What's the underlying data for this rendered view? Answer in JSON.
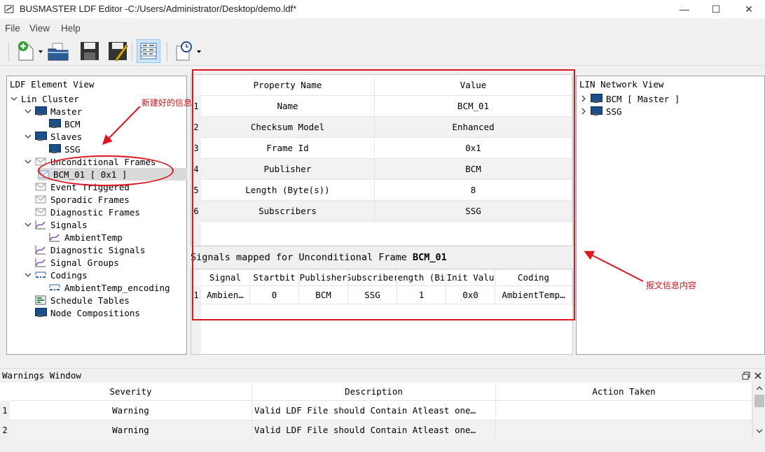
{
  "window": {
    "title": "BUSMASTER LDF Editor -C:/Users/Administrator/Desktop/demo.ldf*",
    "minimize_glyph": "—",
    "maximize_glyph": "☐",
    "close_glyph": "✕"
  },
  "menu": {
    "file": "File",
    "view": "View",
    "help": "Help"
  },
  "toolbar": {
    "icons": [
      "new-icon",
      "open-icon",
      "save-icon",
      "save-as-icon",
      "table-icon",
      "schedule-icon"
    ]
  },
  "left_panel": {
    "title": "LDF Element View",
    "tree": {
      "root": "Lin Cluster",
      "master": "Master",
      "master_bcm": "BCM",
      "slaves": "Slaves",
      "slaves_ssg": "SSG",
      "unconditional_frames": "Unconditional Frames",
      "frame_bcm01": "BCM_01 [ 0x1 ]",
      "event_triggered": "Event Triggered",
      "sporadic_frames": "Sporadic Frames",
      "diagnostic_frames": "Diagnostic Frames",
      "signals": "Signals",
      "signal_ambient": "AmbientTemp",
      "diagnostic_signals": "Diagnostic Signals",
      "signal_groups": "Signal Groups",
      "codings": "Codings",
      "coding_ambient": "AmbientTemp_encoding",
      "schedule_tables": "Schedule Tables",
      "node_compositions": "Node Compositions"
    }
  },
  "property_grid": {
    "headers": [
      "Property Name",
      "Value"
    ],
    "rows": [
      {
        "num": "1",
        "name": "Name",
        "value": "BCM_01"
      },
      {
        "num": "2",
        "name": "Checksum Model",
        "value": "Enhanced"
      },
      {
        "num": "3",
        "name": "Frame Id",
        "value": "0x1"
      },
      {
        "num": "4",
        "name": "Publisher",
        "value": "BCM"
      },
      {
        "num": "5",
        "name": "Length (Byte(s))",
        "value": "8"
      },
      {
        "num": "6",
        "name": "Subscribers",
        "value": "SSG"
      }
    ]
  },
  "signals_section": {
    "label_prefix": "Signals mapped for Unconditional Frame ",
    "label_frame": "BCM_01",
    "headers": [
      "Signal",
      "Startbit",
      "Publisher",
      "Subscriber",
      "Length (Bit",
      "Init Valu",
      "Coding"
    ],
    "rows": [
      {
        "num": "1",
        "cells": [
          "Ambien…",
          "0",
          "BCM",
          "SSG",
          "1",
          "0x0",
          "AmbientTemp…"
        ]
      }
    ]
  },
  "right_panel": {
    "title": "LIN Network View",
    "items": [
      "BCM [ Master ]",
      "SSG"
    ]
  },
  "warnings": {
    "title": "Warnings Window",
    "headers": [
      "Severity",
      "Description",
      "Action Taken"
    ],
    "rows": [
      {
        "num": "1",
        "severity": "Warning",
        "description": "Valid LDF File should Contain Atleast one…",
        "action": ""
      },
      {
        "num": "2",
        "severity": "Warning",
        "description": "Valid LDF File should Contain Atleast one…",
        "action": ""
      }
    ]
  },
  "annotations": {
    "new_info": "新建好的信息",
    "frame_info": "报文信息内容"
  },
  "colors": {
    "annotation_red": "#e0141e",
    "selection_blue": "#cce4f7"
  }
}
